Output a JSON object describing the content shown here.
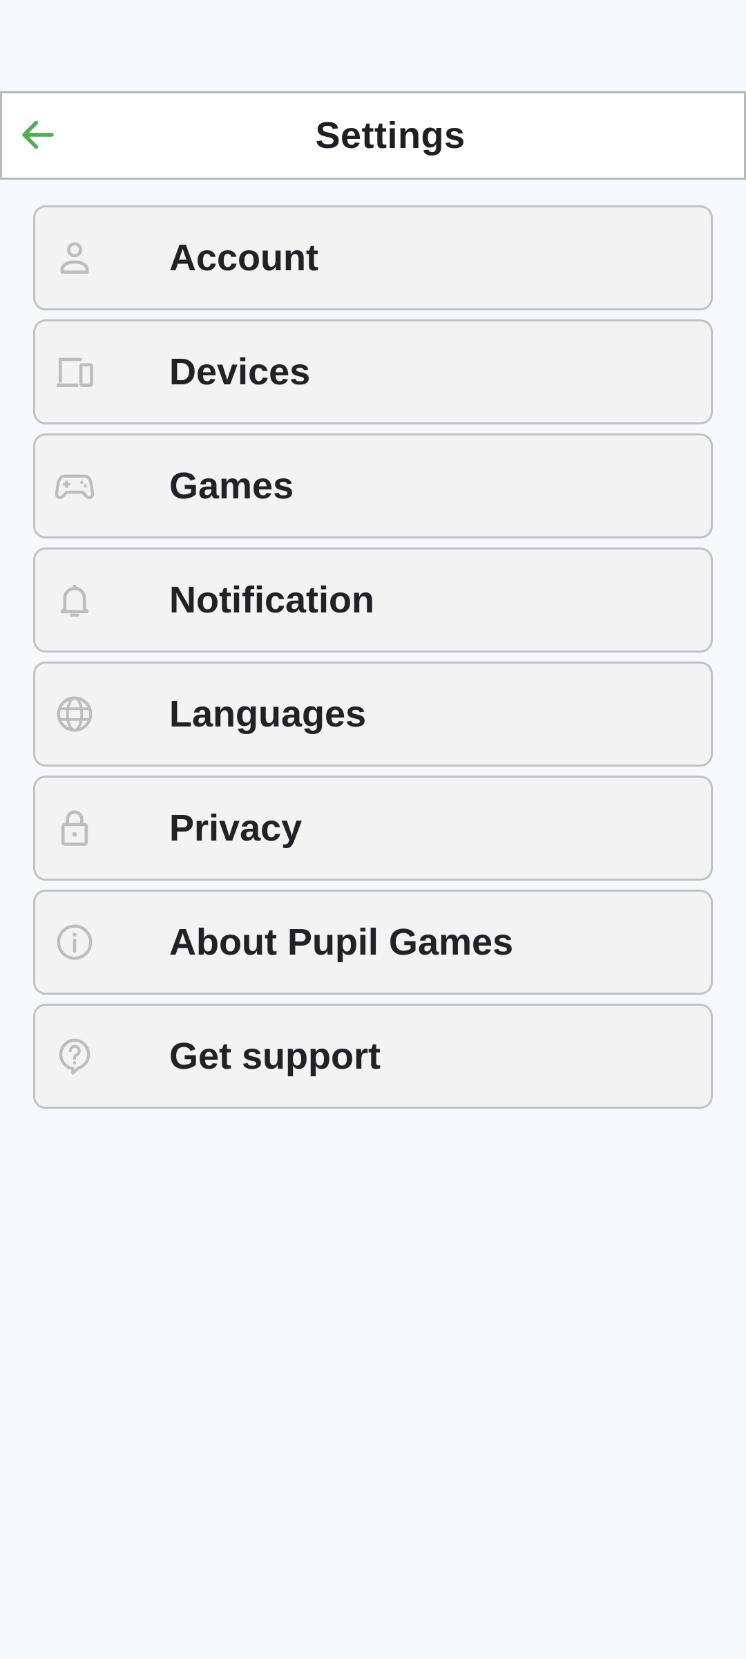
{
  "header": {
    "title": "Settings",
    "back_icon": "arrow-left-icon",
    "accent_color": "#4caf50"
  },
  "settings": {
    "items": [
      {
        "label": "Account",
        "icon": "person-icon"
      },
      {
        "label": "Devices",
        "icon": "devices-icon"
      },
      {
        "label": "Games",
        "icon": "gamepad-icon"
      },
      {
        "label": "Notification",
        "icon": "bell-icon"
      },
      {
        "label": "Languages",
        "icon": "globe-icon"
      },
      {
        "label": "Privacy",
        "icon": "lock-icon"
      },
      {
        "label": "About Pupil Games",
        "icon": "info-icon"
      },
      {
        "label": "Get support",
        "icon": "help-icon"
      }
    ]
  },
  "colors": {
    "background": "#f7f8fc",
    "item_background": "#f3f3f4",
    "item_border": "#c2c2c4",
    "icon_gray": "#bdbdbd",
    "text": "#222226"
  }
}
